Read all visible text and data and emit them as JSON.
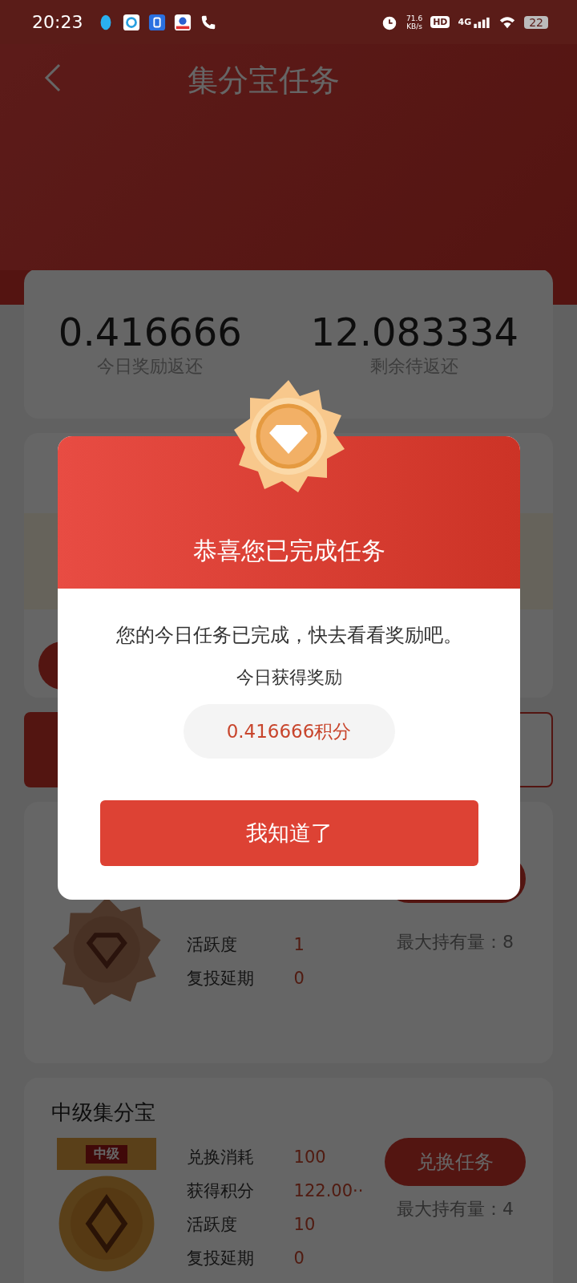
{
  "status_bar": {
    "time": "20:23",
    "net_speed": "71.6",
    "net_unit": "KB/s",
    "hd": "HD",
    "network": "4G",
    "battery": "22"
  },
  "header": {
    "title": "集分宝任务"
  },
  "stats": [
    {
      "value": "0.416666",
      "label": "今日奖励返还"
    },
    {
      "value": "12.083334",
      "label": "剩余待返还"
    }
  ],
  "tasks": [
    {
      "rows": [
        {
          "label": "活跃度",
          "value": "1"
        },
        {
          "label": "复投延期",
          "value": "0"
        }
      ],
      "max_hold": "最大持有量：8"
    },
    {
      "title": "中级集分宝",
      "medal_label": "中级",
      "rows": [
        {
          "label": "兑换消耗",
          "value": "100"
        },
        {
          "label": "获得积分",
          "value": "122.00··"
        },
        {
          "label": "活跃度",
          "value": "10"
        },
        {
          "label": "复投延期",
          "value": "0"
        }
      ],
      "button": "兑换任务",
      "max_hold": "最大持有量：4"
    }
  ],
  "dialog": {
    "title": "恭喜您已完成任务",
    "message": "您的今日任务已完成，快去看看奖励吧。",
    "reward_label": "今日获得奖励",
    "reward": "0.416666积分",
    "button": "我知道了"
  }
}
